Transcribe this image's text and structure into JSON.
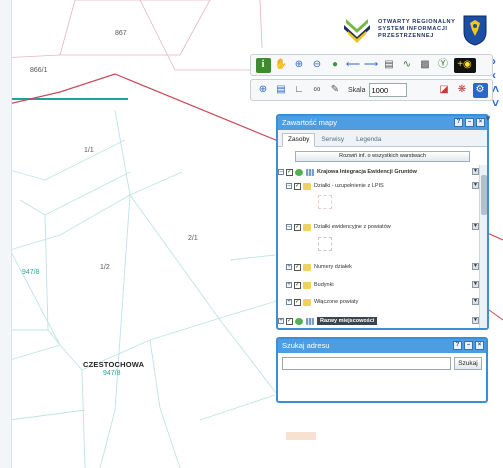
{
  "map": {
    "parcels": {
      "p867": "867",
      "p866_1": "866/1",
      "p1_1": "1/1",
      "p1_2": "1/2",
      "p2_1": "2/1",
      "p947_8a": "947/8",
      "p947_8b": "947/8"
    },
    "city_label": "CZESTOCHOWA",
    "colors": {
      "parcel_line": "#bfe3e3",
      "admin_boundary": "#c94a5a",
      "plot_outline": "#e7b3c0"
    }
  },
  "logo": {
    "line1": "OTWARTY REGIONALNY",
    "line2": "SYSTEM INFORMACJI",
    "line3": "PRZESTRZENNEJ",
    "crest_icon": "silesia-crest-icon"
  },
  "toolbar1": {
    "buttons": [
      "info-icon",
      "pan-hand-icon",
      "zoom-in-icon",
      "zoom-out-icon",
      "globe-icon",
      "back-arrow-icon",
      "forward-arrow-icon",
      "print-icon",
      "chart-icon",
      "lock-icon",
      "help-icon",
      "eye-toggle-icon"
    ]
  },
  "toolbar2": {
    "scale_label": "Skala",
    "scale_value": "1000",
    "buttons": [
      "crosshair-icon",
      "layers-icon",
      "measure-icon",
      "link-icon",
      "draw-icon",
      "ruler-icon",
      "print-pdf-icon",
      "settings-icon",
      "wrench-icon"
    ]
  },
  "layers_panel": {
    "title": "Zawartość mapy",
    "tabs": [
      {
        "label": "Zasoby",
        "active": true
      },
      {
        "label": "Serwisy",
        "active": false
      },
      {
        "label": "Legenda",
        "active": false
      }
    ],
    "collapse_label": "Rozwiń inf. o wszystkich warstwach",
    "layers": [
      {
        "label": "Krajowa Integracja Ewidencji Gruntów",
        "bold": true
      },
      {
        "label": "Działki - uzupełnienie z LPIS"
      },
      {
        "label": "Działki ewidencyjne z powiatów"
      },
      {
        "label": "Numery działek"
      },
      {
        "label": "Budynki"
      },
      {
        "label": "Włączone powiaty"
      },
      {
        "label": "Razwy miejscowości",
        "bold": true
      }
    ]
  },
  "search_panel": {
    "title": "Szukaj adresu",
    "value": "",
    "button_label": "Szukaj"
  }
}
